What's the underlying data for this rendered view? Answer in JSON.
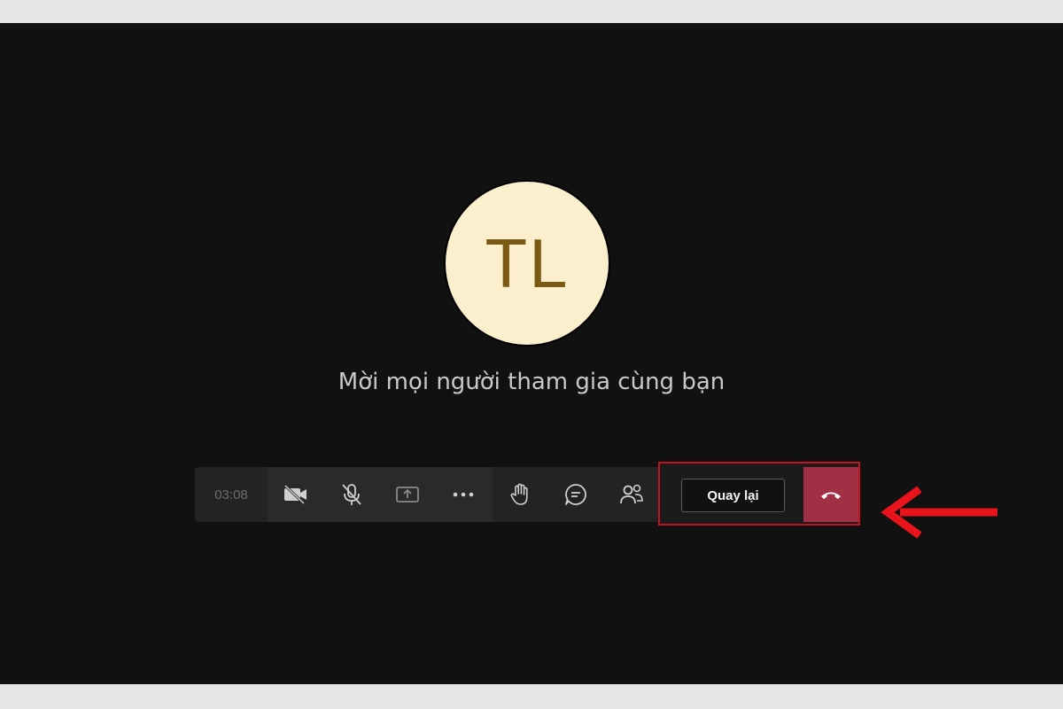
{
  "avatar": {
    "initials": "TL"
  },
  "invite": {
    "text": "Mời mọi người tham gia cùng bạn"
  },
  "toolbar": {
    "timer": "03:08",
    "buttons": [
      {
        "name": "camera-off",
        "icon": "video-off-icon"
      },
      {
        "name": "mic-off",
        "icon": "mic-off-icon"
      },
      {
        "name": "share",
        "icon": "share-screen-icon"
      },
      {
        "name": "more",
        "icon": "more-icon"
      },
      {
        "name": "raise-hand",
        "icon": "hand-icon"
      },
      {
        "name": "chat",
        "icon": "chat-icon"
      },
      {
        "name": "participants",
        "icon": "people-icon"
      }
    ],
    "back_label": "Quay lại",
    "hangup_icon": "phone-hangup-icon"
  },
  "colors": {
    "background": "#111112",
    "avatar_bg": "#fcefcd",
    "avatar_text": "#7a5a12",
    "hangup": "#a13045",
    "highlight": "#c4121f",
    "arrow": "#e8131b"
  }
}
